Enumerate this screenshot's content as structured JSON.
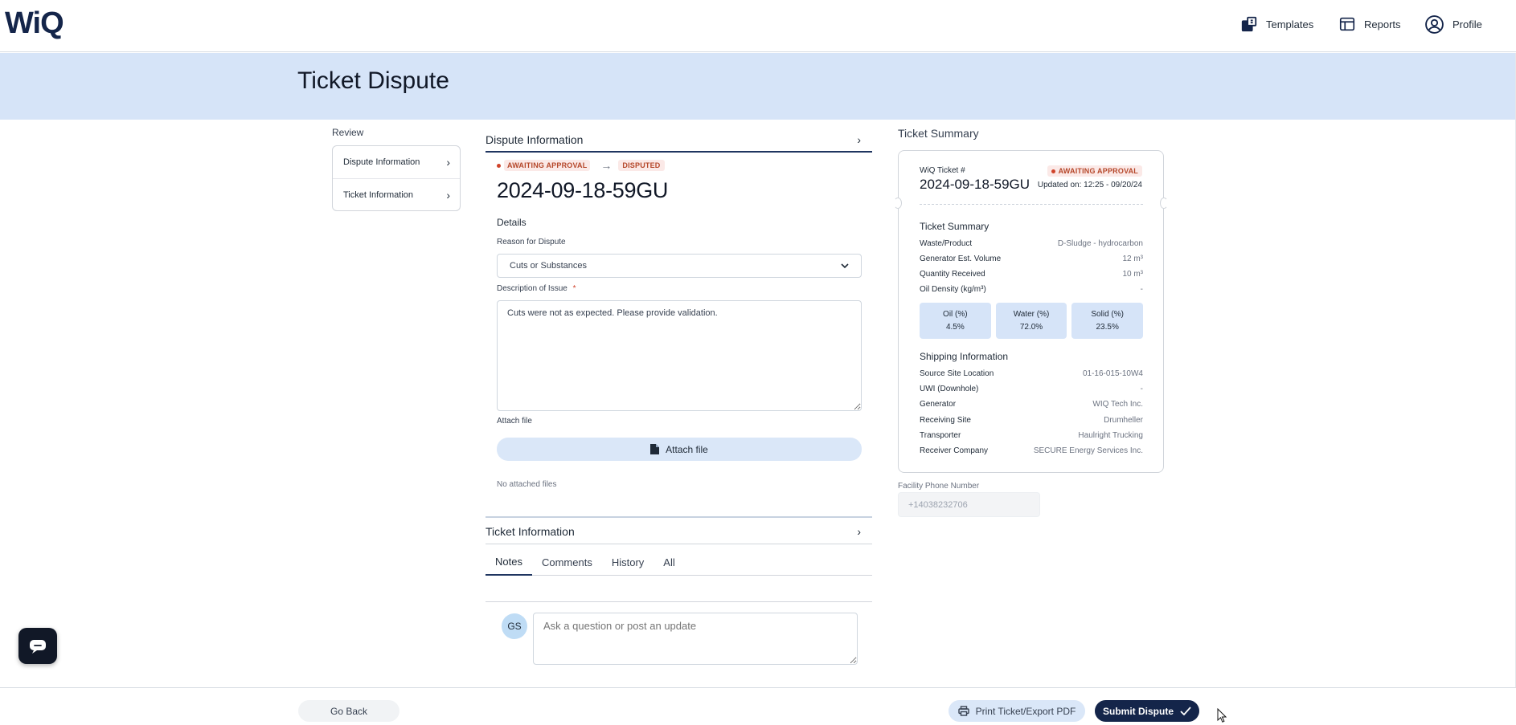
{
  "header": {
    "logo": "WiQ",
    "nav": [
      {
        "label": "Templates",
        "icon": "templates-icon"
      },
      {
        "label": "Reports",
        "icon": "reports-icon"
      },
      {
        "label": "Profile",
        "icon": "profile-icon"
      }
    ]
  },
  "banner": {
    "title": "Ticket Dispute"
  },
  "review": {
    "label": "Review",
    "items": [
      {
        "label": "Dispute Information"
      },
      {
        "label": "Ticket Information"
      }
    ]
  },
  "dispute": {
    "section_title": "Dispute Information",
    "status_from": "AWAITING APPROVAL",
    "status_to": "DISPUTED",
    "ticket_number": "2024-09-18-59GU",
    "details_label": "Details",
    "reason_label": "Reason for Dispute",
    "reason_value": "Cuts or Substances",
    "description_label": "Description of Issue",
    "required_marker": "*",
    "description_value": "Cuts were not as expected. Please provide validation.",
    "attach_label": "Attach file",
    "attach_button": "Attach file",
    "no_files": "No attached files"
  },
  "ticket_info": {
    "section_title": "Ticket Information",
    "tabs": [
      "Notes",
      "Comments",
      "History",
      "All"
    ],
    "active_tab": "Notes",
    "avatar_initials": "GS",
    "comment_placeholder": "Ask a question or post an update"
  },
  "summary": {
    "title": "Ticket Summary",
    "ticket_label": "WiQ Ticket #",
    "ticket_number": "2024-09-18-59GU",
    "status": "AWAITING APPROVAL",
    "updated": "Updated on: 12:25 - 09/20/24",
    "section1_title": "Ticket Summary",
    "rows1": [
      {
        "k": "Waste/Product",
        "v": "D-Sludge - hydrocarbon"
      },
      {
        "k": "Generator Est. Volume",
        "v": "12 m³"
      },
      {
        "k": "Quantity Received",
        "v": "10 m³"
      },
      {
        "k": "Oil Density (kg/m³)",
        "v": "-"
      }
    ],
    "tiles": [
      {
        "label": "Oil (%)",
        "value": "4.5%"
      },
      {
        "label": "Water (%)",
        "value": "72.0%"
      },
      {
        "label": "Solid (%)",
        "value": "23.5%"
      }
    ],
    "section2_title": "Shipping Information",
    "rows2": [
      {
        "k": "Source Site Location",
        "v": "01-16-015-10W4"
      },
      {
        "k": "UWI (Downhole)",
        "v": "-"
      },
      {
        "k": "Generator",
        "v": "WIQ Tech Inc."
      },
      {
        "k": "Receiving Site",
        "v": "Drumheller"
      },
      {
        "k": "Transporter",
        "v": "Haulright Trucking"
      },
      {
        "k": "Receiver Company",
        "v": "SECURE Energy Services Inc."
      }
    ],
    "phone_label": "Facility Phone Number",
    "phone_value": "+14038232706"
  },
  "footer": {
    "go_back": "Go Back",
    "print": "Print Ticket/Export PDF",
    "submit": "Submit Dispute"
  },
  "colors": {
    "brand_navy": "#14254a",
    "banner_blue": "#d6e4f8",
    "status_red": "#d0432a"
  }
}
